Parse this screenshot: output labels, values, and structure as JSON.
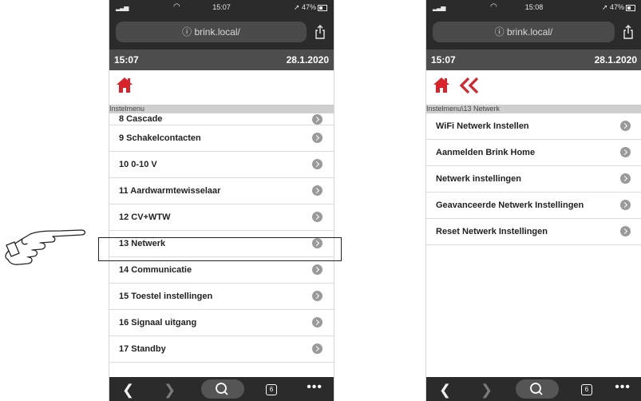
{
  "left_phone": {
    "status": {
      "time": "15:07",
      "battery": "47%"
    },
    "url": "ⓘ brink.local/",
    "header": {
      "time": "15:07",
      "date": "28.1.2020"
    },
    "breadcrumb": "Instelmenu",
    "items": [
      {
        "label": "8 Cascade"
      },
      {
        "label": "9 Schakelcontacten"
      },
      {
        "label": "10 0-10 V"
      },
      {
        "label": "11 Aardwarmtewisselaar"
      },
      {
        "label": "12 CV+WTW"
      },
      {
        "label": "13 Netwerk"
      },
      {
        "label": "14 Communicatie"
      },
      {
        "label": "15 Toestel instellingen"
      },
      {
        "label": "16 Signaal uitgang"
      },
      {
        "label": "17 Standby"
      }
    ],
    "tabs_count": "6"
  },
  "right_phone": {
    "status": {
      "time": "15:08",
      "battery": "47%"
    },
    "url": "ⓘ brink.local/",
    "header": {
      "time": "15:07",
      "date": "28.1.2020"
    },
    "breadcrumb": "Instelmenu\\13 Netwerk",
    "items": [
      {
        "label": "WiFi Netwerk Instellen"
      },
      {
        "label": "Aanmelden Brink Home"
      },
      {
        "label": "Netwerk instellingen"
      },
      {
        "label": "Geavanceerde Netwerk Instellingen"
      },
      {
        "label": "Reset Netwerk Instellingen"
      }
    ],
    "tabs_count": "6"
  },
  "colors": {
    "accent": "#d8232a",
    "header_bg": "#4d4d4d",
    "browser_bg": "#2b2b2b",
    "breadcrumb_bg": "#cfcfcf"
  },
  "icons": [
    "home-icon",
    "double-chevron-left-icon",
    "share-icon",
    "search-icon",
    "tabs-icon",
    "more-icon",
    "chevron-right-icon",
    "pointing-hand-icon"
  ]
}
